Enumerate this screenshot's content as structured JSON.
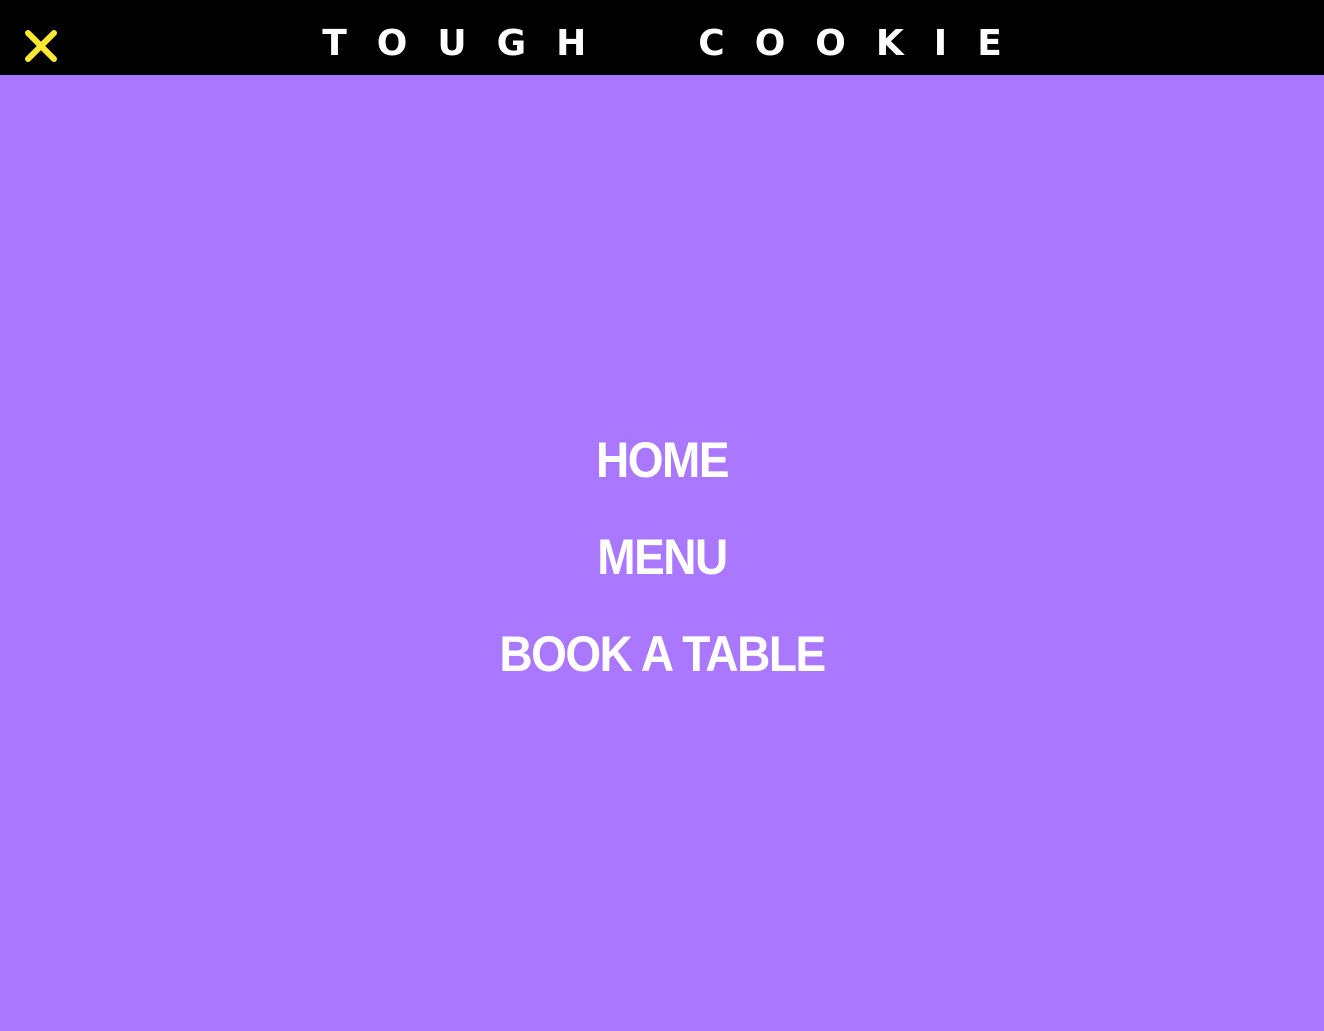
{
  "header": {
    "close_icon": "close-icon",
    "brand_first_word": "TOUGH",
    "brand_second_word": "COOKIE"
  },
  "nav": {
    "items": [
      {
        "label": "HOME"
      },
      {
        "label": "MENU"
      },
      {
        "label": "BOOK A TABLE"
      }
    ]
  },
  "colors": {
    "header_background": "#000000",
    "overlay_background": "#aa78ff",
    "close_icon": "#ffe930",
    "text": "#ffffff"
  }
}
